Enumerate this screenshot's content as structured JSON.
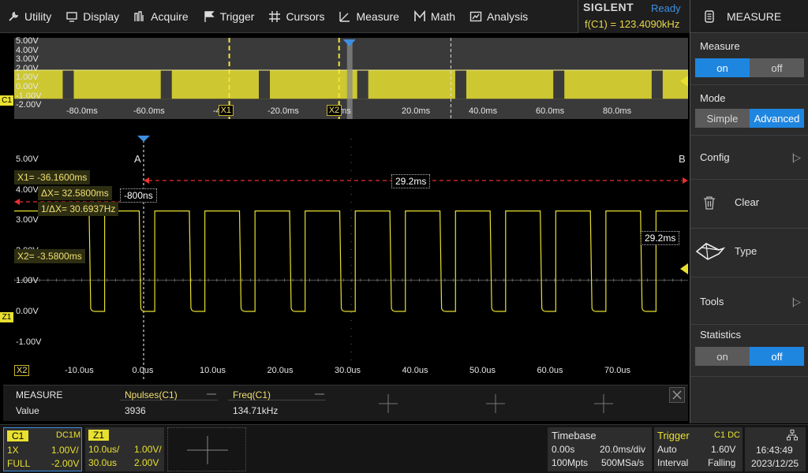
{
  "menu": {
    "items": [
      "Utility",
      "Display",
      "Acquire",
      "Trigger",
      "Cursors",
      "Measure",
      "Math",
      "Analysis"
    ]
  },
  "brand": {
    "name": "SIGLENT",
    "status": "Ready",
    "freq": "f(C1) = 123.4090kHz"
  },
  "right_panel": {
    "title": "MEASURE",
    "measure_label": "Measure",
    "measure_on": "on",
    "measure_off": "off",
    "mode_label": "Mode",
    "mode_simple": "Simple",
    "mode_advanced": "Advanced",
    "config": "Config",
    "clear": "Clear",
    "type": "Type",
    "tools": "Tools",
    "statistics_label": "Statistics",
    "stats_on": "on",
    "stats_off": "off"
  },
  "overview": {
    "channel_tag": "C1",
    "y_labels": [
      "5.00V",
      "4.00V",
      "3.00V",
      "2.00V",
      "1.00V",
      "0.00V",
      "-1.00V",
      "-2.00V"
    ],
    "x_labels": [
      "-80.0ms",
      "-60.0ms",
      "-40",
      "-20.0ms",
      "0ms",
      "20.0ms",
      "40.0ms",
      "60.0ms",
      "80.0ms"
    ],
    "cursor_x1": "X1",
    "cursor_x2": "X2",
    "gaps_ms": [
      -85.6,
      -56.5,
      -27.4,
      1.8,
      30.9,
      60.0,
      89.2
    ],
    "zoom_window_ms": [
      -1.0,
      0.0
    ],
    "cursor_x1_ms": -36.16,
    "cursor_x2_ms": -3.58,
    "marker_ms": 29.6
  },
  "zoom": {
    "y_labels": [
      "5.00V",
      "4.00V",
      "3.00V",
      "2.00V",
      "1.00V",
      "0.00V",
      "-1.00V"
    ],
    "x_labels": [
      "-10.0us",
      "0.0us",
      "10.0us",
      "20.0us",
      "30.0us",
      "40.0us",
      "50.0us",
      "60.0us",
      "70.0us"
    ],
    "x2_tag": "X2",
    "channel_tag": "Z1",
    "marker_a": "A",
    "marker_b": "B",
    "x1_readout": "X1= -36.1600ms",
    "dx_readout": "ΔX= 32.5800ms",
    "inv_dx_readout": "1/ΔX= 30.6937Hz",
    "x2_readout": "X2= -3.5800ms",
    "trig_offset": "-800ns",
    "span_label": "29.2ms",
    "span_label_2": "29.2ms",
    "pulse_period_us": 7.43,
    "pulse_low_width_us": 2.3,
    "first_low_us": 0.0,
    "high_level_v": 3.3,
    "low_level_v": 0.0
  },
  "measure": {
    "title": "MEASURE",
    "row_label": "Value",
    "col1_name": "Npulses(C1)",
    "col1_value": "3936",
    "col2_name": "Freq(C1)",
    "col2_value": "134.71kHz"
  },
  "bottom": {
    "c1": {
      "tag": "C1",
      "coupling": "DC1M",
      "probe": "1X",
      "scale": "1.00V/",
      "bw": "FULL",
      "offset": "-2.00V"
    },
    "z1": {
      "tag": "Z1",
      "tdiv": "10.0us/",
      "vdiv": "1.00V/",
      "delay": "30.0us",
      "offset": "2.00V"
    },
    "timebase": {
      "title": "Timebase",
      "delay": "0.00s",
      "tdiv": "20.0ms/div",
      "mem": "100Mpts",
      "rate": "500MSa/s"
    },
    "trigger": {
      "title": "Trigger",
      "source": "C1 DC",
      "mode": "Auto",
      "level": "1.60V",
      "type": "Interval",
      "slope": "Falling"
    },
    "clock": {
      "time": "16:43:49",
      "date": "2023/12/25"
    }
  },
  "colors": {
    "trace": "#e8e030",
    "cursor": "#f2e33a",
    "accent": "#1f86e0",
    "marker": "#e83030",
    "trigger": "#3d8fe0"
  }
}
